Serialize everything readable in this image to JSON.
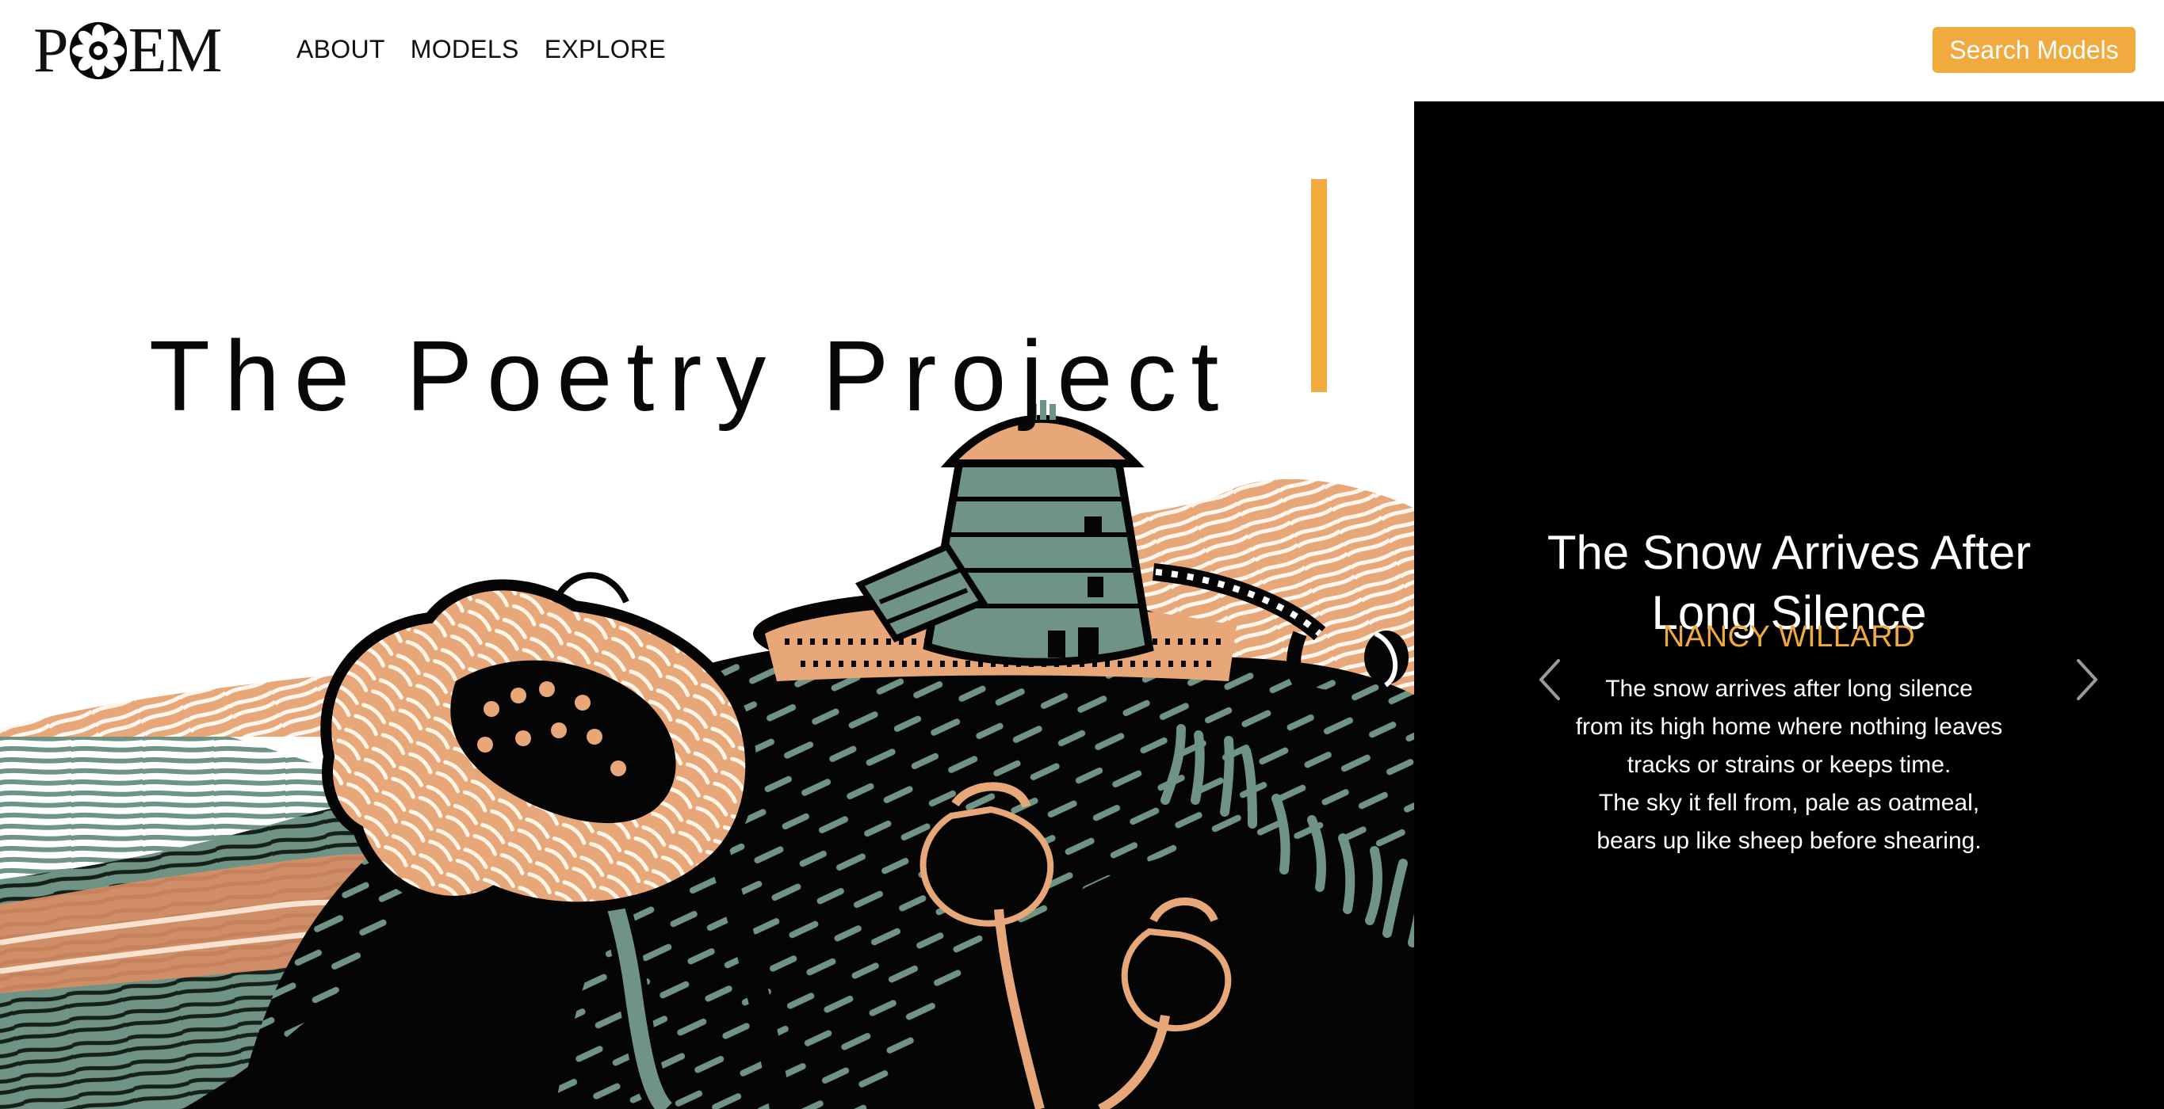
{
  "brand": {
    "logo_prefix": "P",
    "logo_suffix": "EM",
    "logo_mark_icon": "flower-rosette-icon"
  },
  "nav": {
    "items": [
      "ABOUT",
      "MODELS",
      "EXPLORE"
    ]
  },
  "header": {
    "search_button_label": "Search Models"
  },
  "hero": {
    "title": "The Poetry Project"
  },
  "poem_card": {
    "title_line1": "The Snow Arrives After",
    "title_line2": "Long Silence",
    "author": "NANCY WILLARD",
    "lines": [
      "The snow arrives after long silence",
      "from its high home where nothing leaves",
      "tracks or strains or keeps time.",
      "The sky it fell from, pale as oatmeal,",
      "bears up like sheep before shearing."
    ],
    "prev_icon": "chevron-left-icon",
    "next_icon": "chevron-right-icon"
  },
  "colors": {
    "accent": "#f1aa3e",
    "panel_background": "#000000",
    "illustration_sage": "#6f9485",
    "illustration_peach": "#e8a778",
    "illustration_ink": "#050505"
  }
}
